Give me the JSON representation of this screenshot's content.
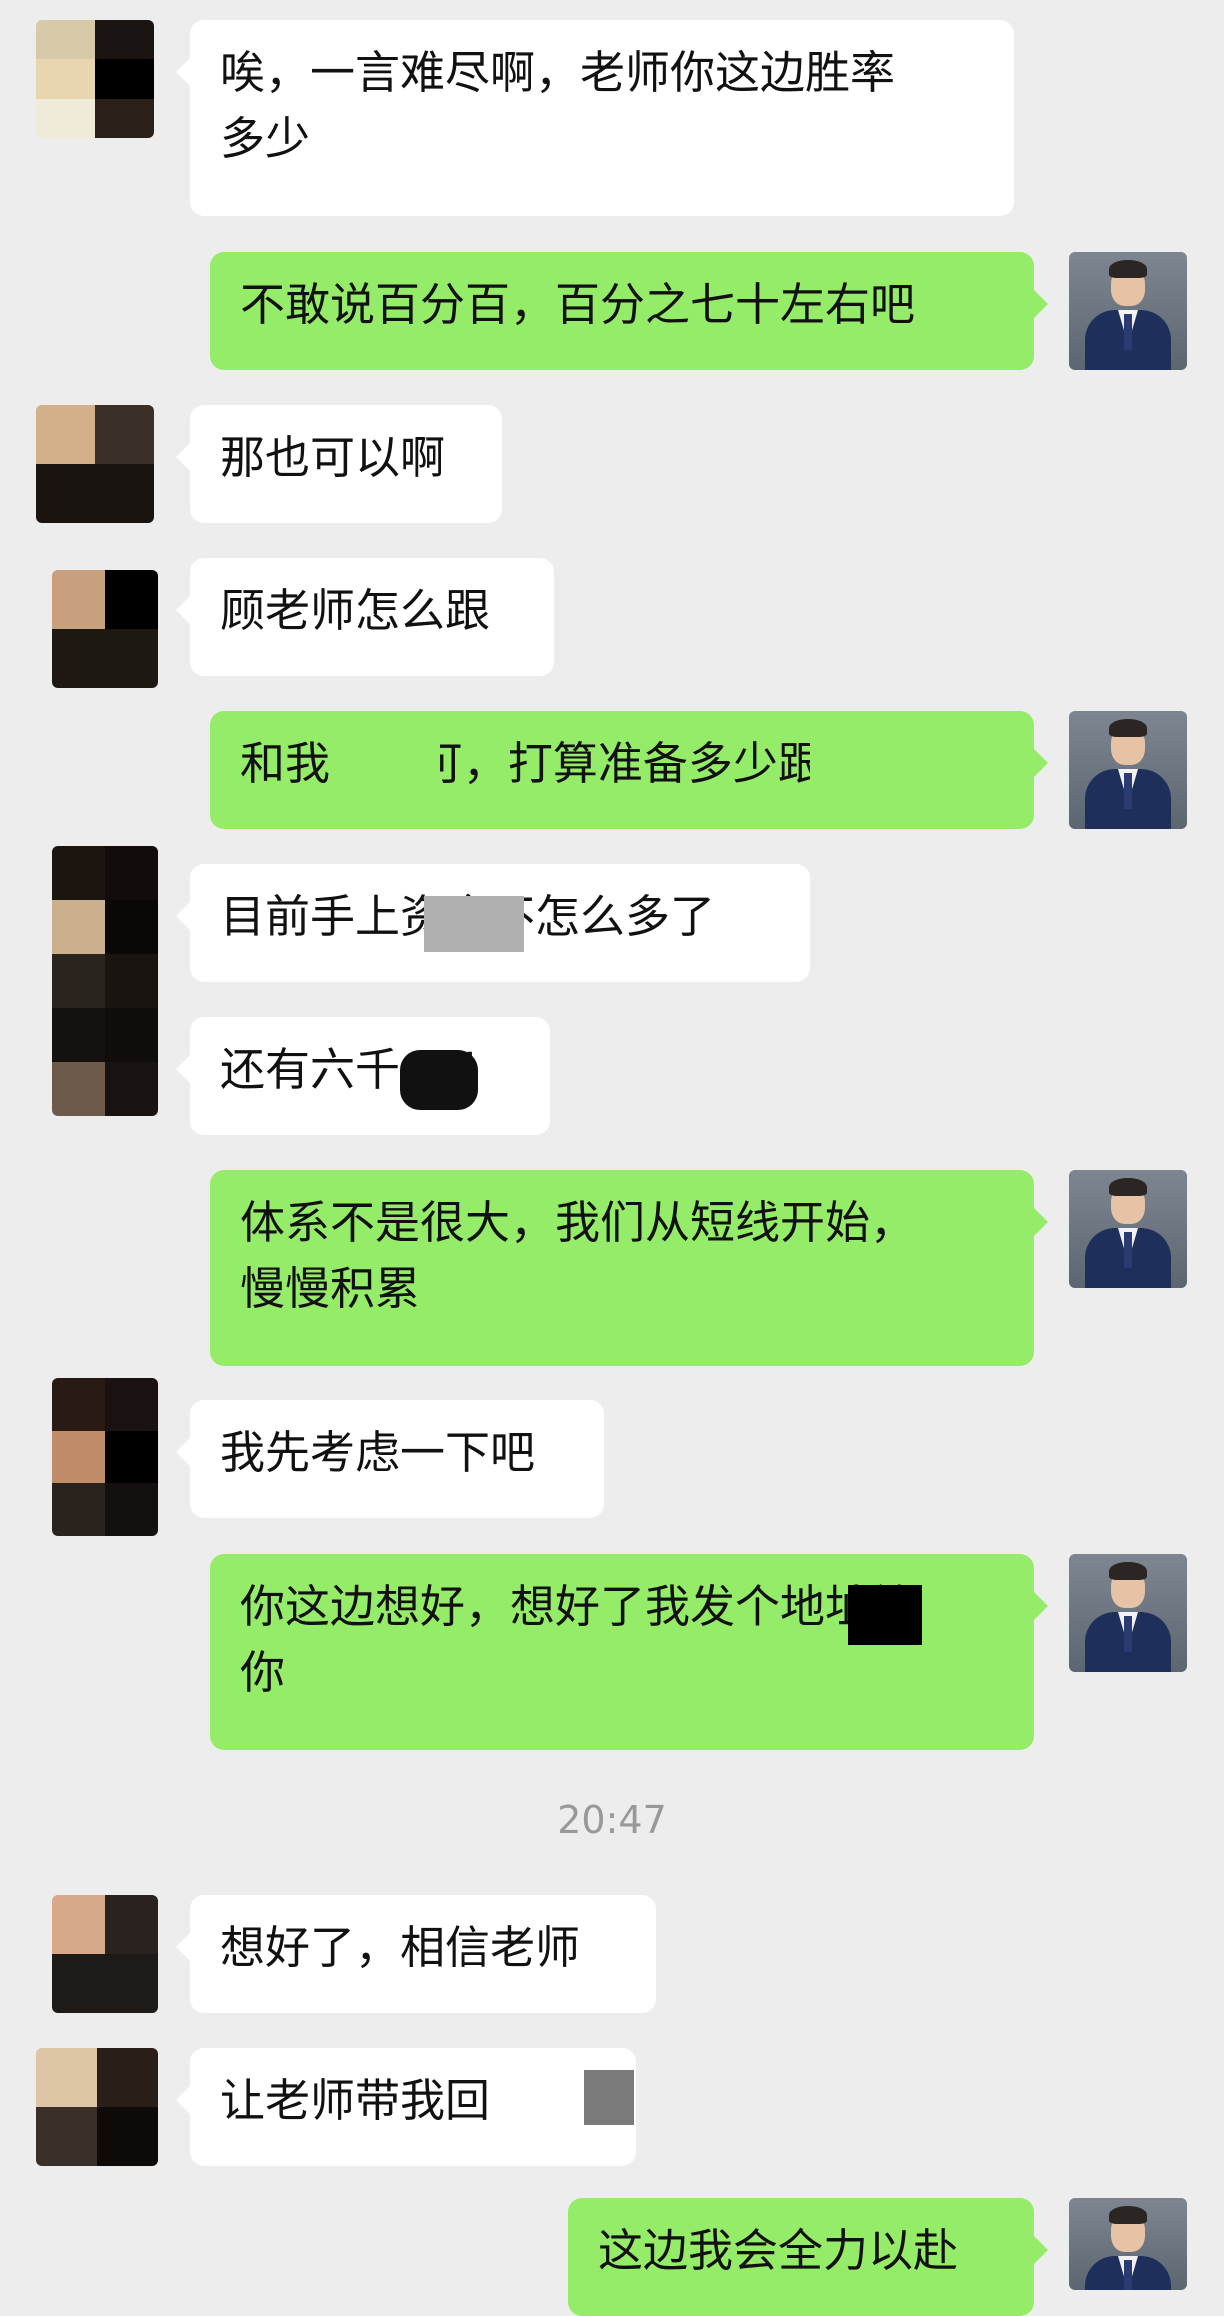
{
  "messages": [
    {
      "from": "contact",
      "text": "唉，一言难尽啊，老师你这边胜率\n多少"
    },
    {
      "from": "teacher",
      "text": "不敢说百分百，百分之七十左右吧"
    },
    {
      "from": "contact",
      "text": "那也可以啊"
    },
    {
      "from": "contact",
      "text": "顾老师怎么跟"
    },
    {
      "from": "teacher",
      "text": "和我   即可，打算准备多少跟上"
    },
    {
      "from": "contact",
      "text": "目前手上资金不怎么多了"
    },
    {
      "from": "contact",
      "text": "还有六千   U"
    },
    {
      "from": "teacher",
      "text": "体系不是很大，我们从短线开始，\n慢慢积累"
    },
    {
      "from": "contact",
      "text": "我先考虑一下吧"
    },
    {
      "from": "teacher",
      "text": "你这边想好，想好了我发个地址给\n你"
    },
    {
      "from": "contact",
      "text": "想好了，相信老师"
    },
    {
      "from": "contact",
      "text": "让老师带我回   "
    },
    {
      "from": "teacher",
      "text": "这边我会全力以赴"
    }
  ],
  "timestamp": "20:47",
  "colors": {
    "background": "#ededed",
    "incoming_bubble": "#ffffff",
    "outgoing_bubble": "#95ec69",
    "timestamp_text": "#999999"
  },
  "icons": [
    "contact-avatar-pixelated",
    "teacher-avatar-photo"
  ]
}
